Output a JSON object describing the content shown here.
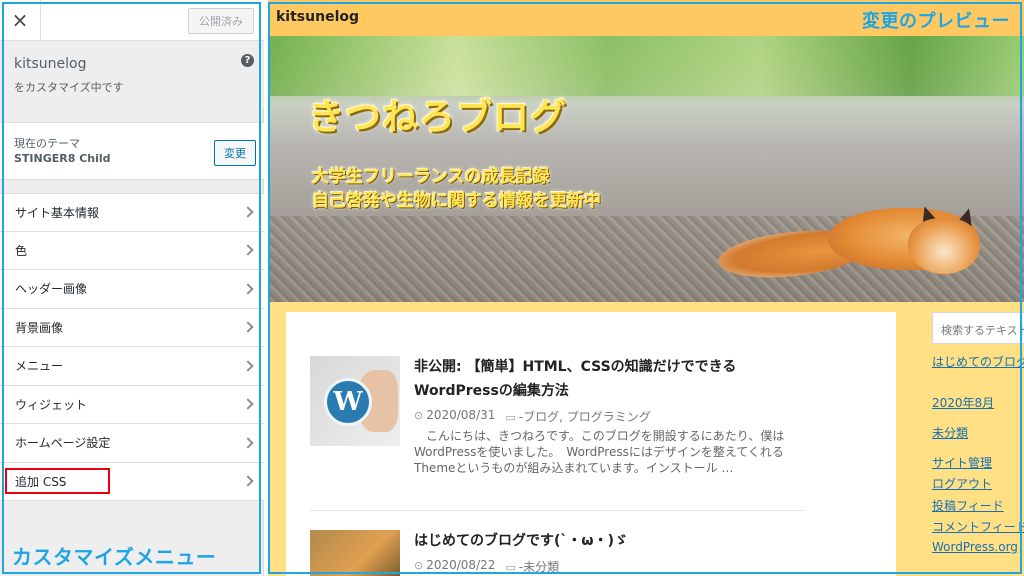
{
  "panel": {
    "close_icon": "close-icon",
    "close_glyph": "×",
    "publish_label": "公開済み",
    "site_name": "kitsunelog",
    "site_subtitle": "をカスタマイズ中です",
    "help_glyph": "?",
    "theme_label": "現在のテーマ",
    "theme_name": "STINGER8 Child",
    "change_label": "変更",
    "menu": [
      {
        "label": "サイト基本情報"
      },
      {
        "label": "色"
      },
      {
        "label": "ヘッダー画像"
      },
      {
        "label": "背景画像"
      },
      {
        "label": "メニュー"
      },
      {
        "label": "ウィジェット"
      },
      {
        "label": "ホームページ設定"
      },
      {
        "label": "追加 CSS"
      }
    ],
    "caption": "カスタマイズメニュー"
  },
  "preview": {
    "site_name": "kitsunelog",
    "caption": "変更のプレビュー",
    "hero": {
      "title": "きつねろブログ",
      "subtitle_line1": "大学生フリーランスの成長記録",
      "subtitle_line2": "自己啓発や生物に関する情報を更新中"
    },
    "posts": [
      {
        "title": "非公開: 【簡単】HTML、CSSの知識だけでできるWordPressの編集方法",
        "date": "2020/08/31",
        "categories": "-ブログ, プログラミング",
        "excerpt": "　こんにちは、きつねろです。このブログを開設するにあたり、僕はWordPressを使いました。　WordPressにはデザインを整えてくれるThemeというものが組み込まれています。インストール …",
        "thumb_glyph": "W"
      },
      {
        "title": "はじめてのブログです(`・ω・)ゞ",
        "date": "2020/08/22",
        "categories": "-未分類"
      }
    ],
    "sidebar": {
      "search_placeholder": "検索するテキスト",
      "links": [
        "はじめてのブログ",
        "2020年8月",
        "未分類",
        "サイト管理",
        "ログアウト",
        "投稿フィード",
        "コメントフィード",
        "WordPress.org"
      ]
    }
  },
  "colors": {
    "accent_blue": "#1ea5e6",
    "highlight_red": "#e5000f",
    "preview_bar": "#ffc861",
    "preview_bg": "#ffe085",
    "link_blue": "#1a6fb0"
  }
}
